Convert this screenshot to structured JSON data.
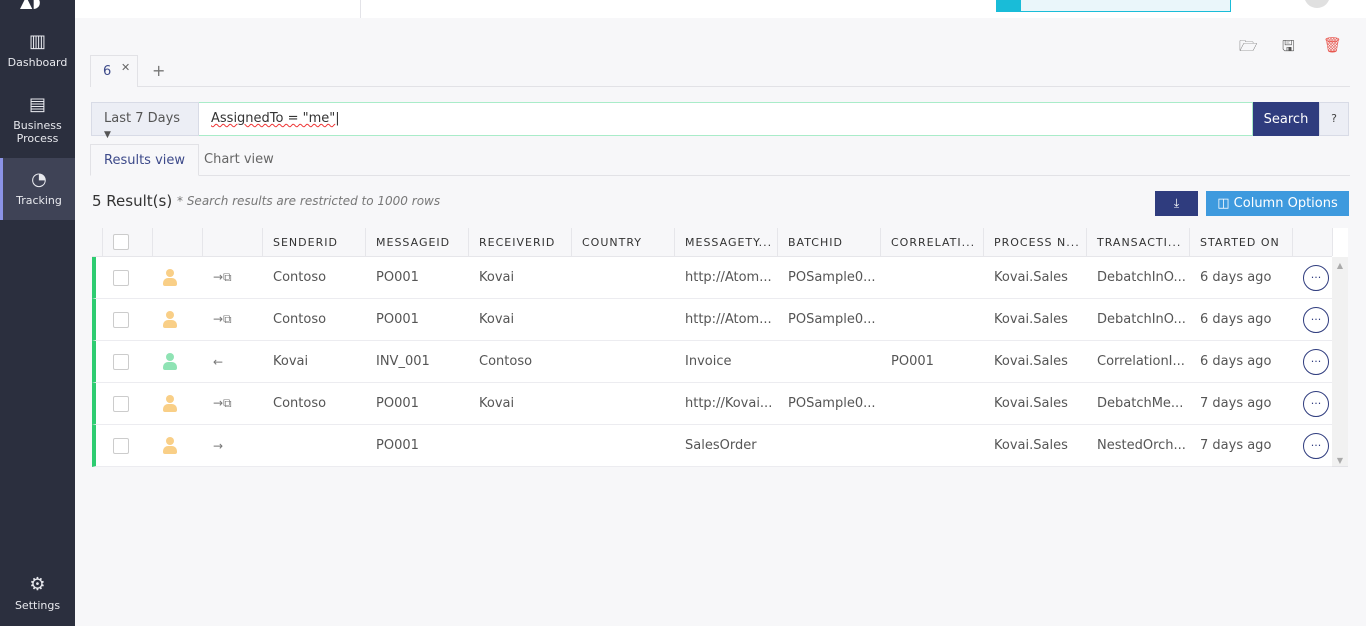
{
  "sidebar": {
    "items": [
      {
        "label": "Dashboard",
        "icon": "bar-chart-icon"
      },
      {
        "label": "Business Process",
        "icon": "list-icon"
      },
      {
        "label": "Tracking",
        "icon": "pie-chart-icon",
        "active": true
      },
      {
        "label": "Settings",
        "icon": "gear-icon"
      }
    ]
  },
  "query_tabs": [
    {
      "label": "6"
    }
  ],
  "search": {
    "range": "Last 7 Days",
    "query": "AssignedTo = \"me\"",
    "button": "Search"
  },
  "view_tabs": [
    {
      "label": "Results view",
      "active": true
    },
    {
      "label": "Chart view"
    }
  ],
  "results": {
    "count": "5 Result(s)",
    "note": "* Search results are restricted to 1000 rows",
    "column_options": "Column Options"
  },
  "columns": [
    "SENDERID",
    "MESSAGEID",
    "RECEIVERID",
    "COUNTRY",
    "MESSAGETY...",
    "BATCHID",
    "CORRELATI...",
    "PROCESS N...",
    "TRANSACTI...",
    "STARTED ON"
  ],
  "rows": [
    {
      "status_color": "#f9cf87",
      "direction": "→⧉",
      "cells": [
        "Contoso",
        "PO001",
        "Kovai",
        "",
        "http://Atom...",
        "POSample0...",
        "",
        "Kovai.Sales",
        "DebatchInO...",
        "6 days ago"
      ]
    },
    {
      "status_color": "#f9cf87",
      "direction": "→⧉",
      "cells": [
        "Contoso",
        "PO001",
        "Kovai",
        "",
        "http://Atom...",
        "POSample0...",
        "",
        "Kovai.Sales",
        "DebatchInO...",
        "6 days ago"
      ]
    },
    {
      "status_color": "#8fe3b4",
      "direction": "←",
      "cells": [
        "Kovai",
        "INV_001",
        "Contoso",
        "",
        "Invoice",
        "",
        "PO001",
        "Kovai.Sales",
        "CorrelationI...",
        "6 days ago"
      ]
    },
    {
      "status_color": "#f9cf87",
      "direction": "→⧉",
      "cells": [
        "Contoso",
        "PO001",
        "Kovai",
        "",
        "http://Kovai...",
        "POSample0...",
        "",
        "Kovai.Sales",
        "DebatchMe...",
        "7 days ago"
      ]
    },
    {
      "status_color": "#f9cf87",
      "direction": "→",
      "cells": [
        "",
        "PO001",
        "",
        "",
        "SalesOrder",
        "",
        "",
        "Kovai.Sales",
        "NestedOrch...",
        "7 days ago"
      ]
    }
  ],
  "colors": {
    "sidebar": "#2b2f3e",
    "primary": "#2f3c7e",
    "accent": "#3e9ade",
    "row_status": "#2ecc71",
    "delete": "#e8574f"
  }
}
